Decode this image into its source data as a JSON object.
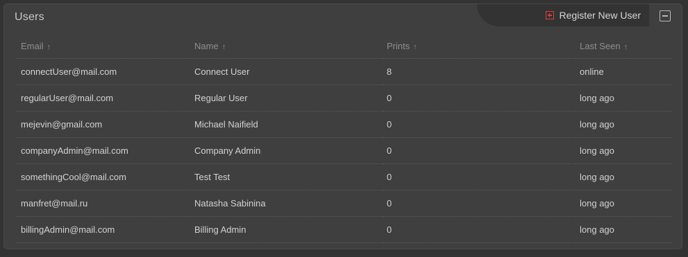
{
  "panel": {
    "title": "Users",
    "register_label": "Register New User"
  },
  "table": {
    "columns": [
      {
        "label": "Email",
        "sort_icon": "↑"
      },
      {
        "label": "Name",
        "sort_icon": "↑"
      },
      {
        "label": "Prints",
        "sort_icon": "↑"
      },
      {
        "label": "Last Seen",
        "sort_icon": "↑"
      }
    ],
    "rows": [
      {
        "email": "connectUser@mail.com",
        "name": "Connect User",
        "prints": "8",
        "last_seen": "online"
      },
      {
        "email": "regularUser@mail.com",
        "name": "Regular User",
        "prints": "0",
        "last_seen": "long ago"
      },
      {
        "email": "mejevin@gmail.com",
        "name": "Michael Naifield",
        "prints": "0",
        "last_seen": "long ago"
      },
      {
        "email": "companyAdmin@mail.com",
        "name": "Company Admin",
        "prints": "0",
        "last_seen": "long ago"
      },
      {
        "email": "somethingCool@mail.com",
        "name": "Test Test",
        "prints": "0",
        "last_seen": "long ago"
      },
      {
        "email": "manfret@mail.ru",
        "name": "Natasha Sabinina",
        "prints": "0",
        "last_seen": "long ago"
      },
      {
        "email": "billingAdmin@mail.com",
        "name": "Billing Admin",
        "prints": "0",
        "last_seen": "long ago"
      }
    ]
  },
  "colors": {
    "background": "#333333",
    "panel": "#3f3f3f",
    "accent_red": "#e03c3c"
  },
  "icons": {
    "register": "plus-square-icon",
    "collapse": "minus-square-icon",
    "sort": "sort-arrow-up-icon"
  }
}
